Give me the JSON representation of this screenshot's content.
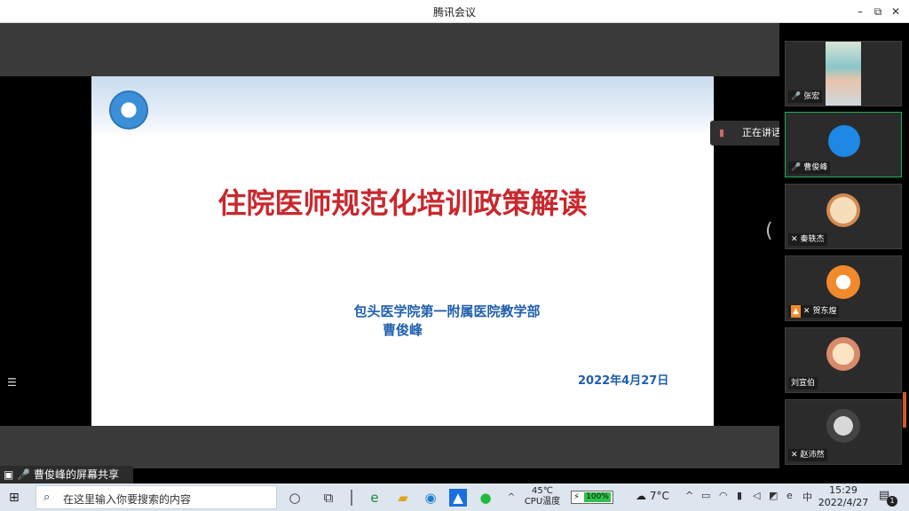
{
  "app": {
    "title": "腾讯会议"
  },
  "window_controls": {
    "minimize": "–",
    "restore": "⧉",
    "close": "✕"
  },
  "slide": {
    "main_title": "住院医师规范化培训政策解读",
    "organization": "包头医学院第一附属医院教学部",
    "presenter": "曹俊峰",
    "date": "2022年4月27日"
  },
  "share_label": "曹俊峰的屏幕共享",
  "speaking_banner": {
    "text": "正在讲话: 曹俊峰;"
  },
  "participants": [
    {
      "name": "张宏",
      "icon": "mic-icon"
    },
    {
      "name": "曹俊峰",
      "icon": "mic-icon"
    },
    {
      "name": "秦轶杰",
      "icon": "mic-muted-icon"
    },
    {
      "name": "贺东煌",
      "icon": "mic-muted-icon"
    },
    {
      "name": "刘宣伯",
      "icon": "none"
    },
    {
      "name": "赵沛然",
      "icon": "mic-muted-icon"
    }
  ],
  "taskbar": {
    "search_placeholder": "在这里输入你要搜索的内容",
    "cpu_temp": "45℃",
    "cpu_label": "CPU温度",
    "battery": "100%",
    "weather": "7°C",
    "ime": "中",
    "time": "15:29",
    "date": "2022/4/27",
    "notifications": "1"
  }
}
